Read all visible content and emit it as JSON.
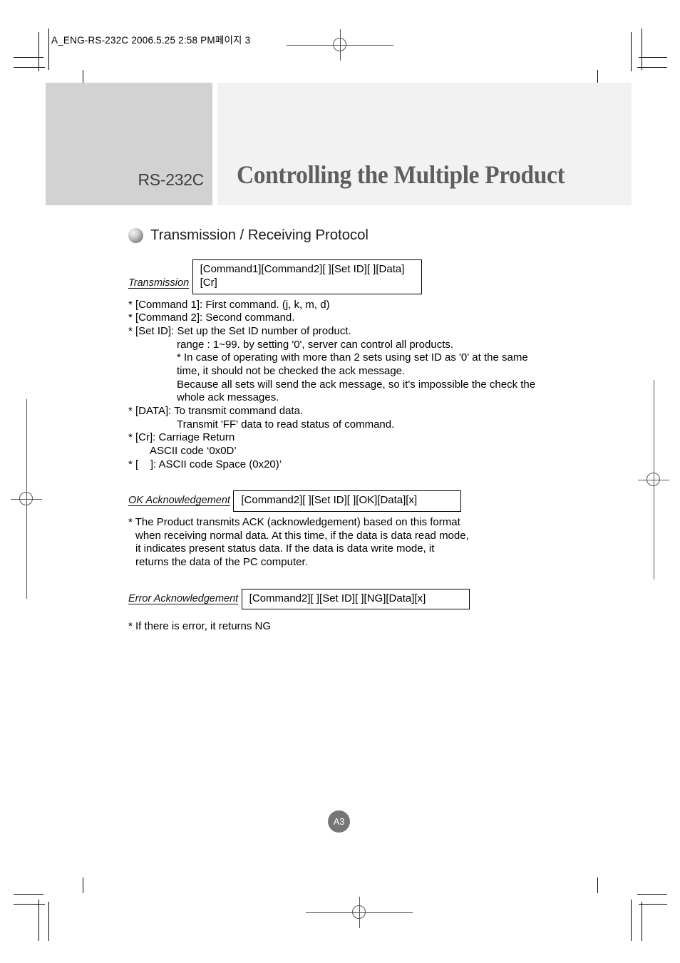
{
  "print_slug": "A_ENG-RS-232C  2006.5.25  2:58 PM페이지 3",
  "header": {
    "tag_label": "RS-232C",
    "title": "Controlling the Multiple Product",
    "tag_bg": "#d2d2d2",
    "panel_bg": "#f2f2f2",
    "title_color": "#5e5e5e"
  },
  "section": {
    "bullet_icon": "sphere-bullet-icon",
    "heading": "Transmission / Receiving Protocol"
  },
  "transmission": {
    "sub_head": "Transmission",
    "command_format": "[Command1][Command2][ ][Set ID][ ][Data][Cr]",
    "lines": [
      "* [Command 1]: First command. (j, k, m, d)",
      "* [Command 2]: Second command.",
      "* [Set ID]: Set up the Set ID number of product."
    ],
    "indented_lines": [
      "range : 1~99. by setting '0', server can control all products.",
      "* In case of operating with more than 2 sets using set ID as '0' at the same",
      "time, it should not be checked the ack message."
    ],
    "indented_lines_2": [
      "Because all sets will send the ack message, so it's impossible the check the",
      "whole ack messages."
    ],
    "data_line": "* [DATA]: To transmit command data.",
    "data_indented": "Transmit 'FF' data to read status of command.",
    "cr_line": "* [Cr]: Carriage Return",
    "cr_indented": "ASCII code ‘0x0D’",
    "space_line": "* [    ]: ASCII code Space (0x20)’"
  },
  "ok_ack": {
    "sub_head": "OK Acknowledgement",
    "command_format": "[Command2][ ][Set ID][ ][OK][Data][x]",
    "body": "* The Product transmits ACK (acknowledgement) based on this format when receiving normal data. At this time, if the data is data read mode, it indicates present status data. If the data is data write mode, it returns the data of the PC computer."
  },
  "error_ack": {
    "sub_head": "Error Acknowledgement",
    "command_format": "[Command2][ ][Set ID][ ][NG][Data][x]",
    "body": "* If there is error, it returns NG"
  },
  "page_number": "A3"
}
